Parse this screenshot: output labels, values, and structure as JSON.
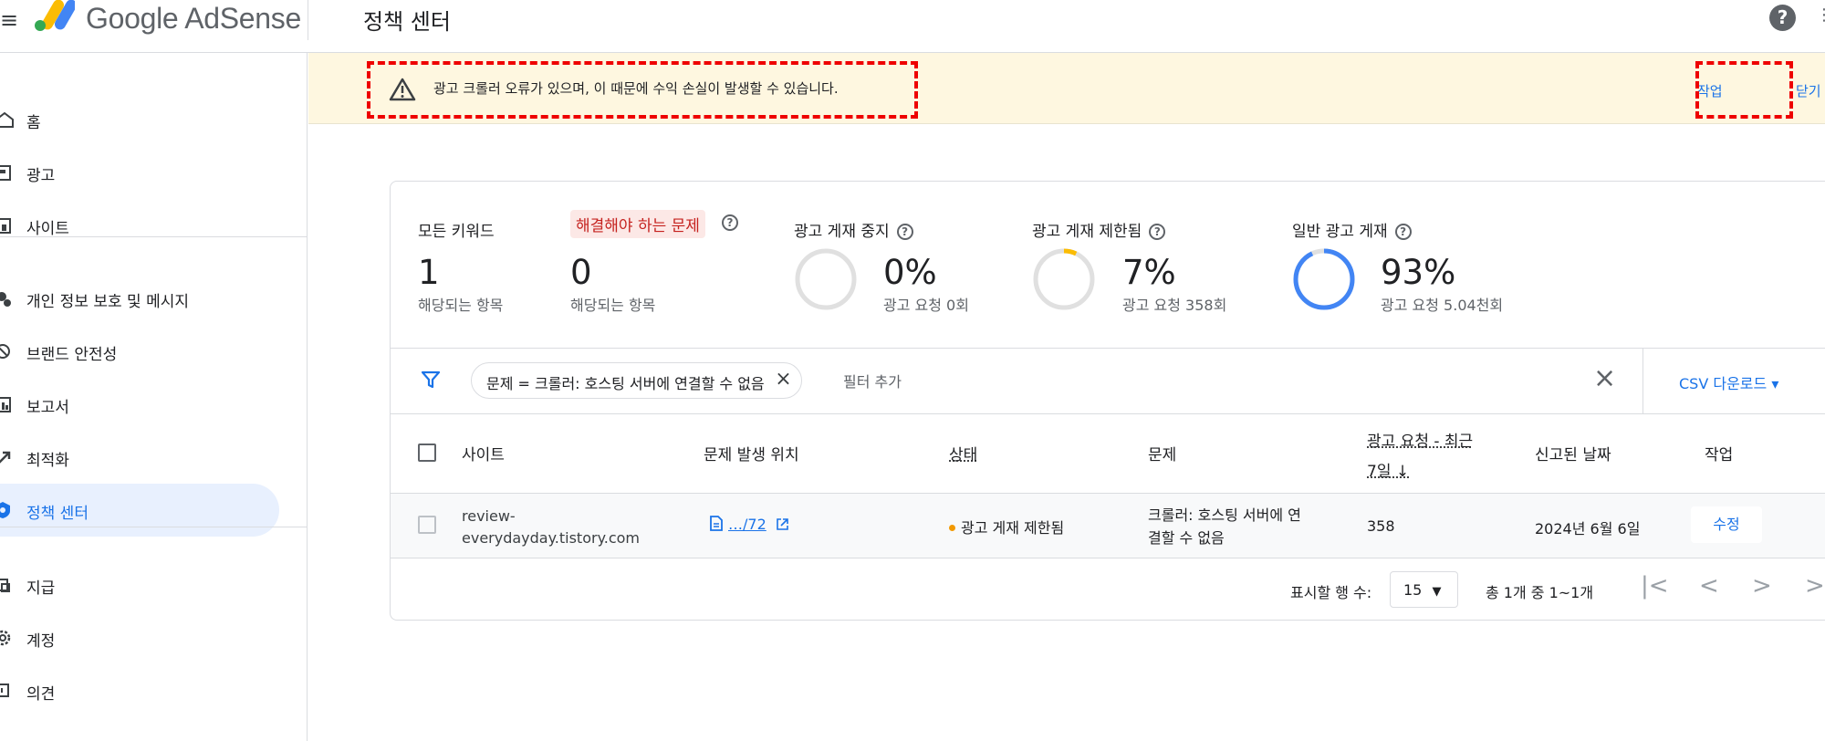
{
  "app": {
    "brand": "Google AdSense",
    "page_title": "정책 센터",
    "help": "?",
    "more": "⋮"
  },
  "sidebar": {
    "items": [
      {
        "label": "홈",
        "icon": "home-icon"
      },
      {
        "label": "광고",
        "icon": "ads-icon"
      },
      {
        "label": "사이트",
        "icon": "sites-icon"
      },
      {
        "label": "개인 정보 보호 및 메시지",
        "icon": "privacy-icon"
      },
      {
        "label": "브랜드 안전성",
        "icon": "brand-safety-icon"
      },
      {
        "label": "보고서",
        "icon": "reports-icon"
      },
      {
        "label": "최적화",
        "icon": "optimization-icon"
      },
      {
        "label": "정책 센터",
        "icon": "policy-center-icon",
        "active": true
      },
      {
        "label": "지급",
        "icon": "payments-icon"
      },
      {
        "label": "계정",
        "icon": "gear-icon"
      },
      {
        "label": "의견",
        "icon": "feedback-icon"
      }
    ]
  },
  "banner": {
    "message": "광고 크롤러 오류가 있으며, 이 때문에 수익 손실이 발생할 수 있습니다.",
    "action_label": "작업",
    "close_label": "닫기"
  },
  "stats": {
    "all_keywords": {
      "label": "모든 키워드",
      "value": "1",
      "sub": "해당되는 항목"
    },
    "issues": {
      "label": "해결해야 하는 문제",
      "value": "0",
      "sub": "해당되는 항목"
    },
    "ads_stopped": {
      "label": "광고 게재 중지",
      "value": "0%",
      "sub": "광고 요청 0회",
      "fraction": 0
    },
    "ads_limited": {
      "label": "광고 게재 제한됨",
      "value": "7%",
      "sub": "광고 요청 358회",
      "fraction": 0.07
    },
    "ads_normal": {
      "label": "일반 광고 게재",
      "value": "93%",
      "sub": "광고 요청 5.04천회",
      "fraction": 0.93
    }
  },
  "filter": {
    "chip_label": "문제 = 크롤러: 호스팅 서버에 연결할 수 없음",
    "add_filter": "필터 추가",
    "csv_label": "CSV 다운로드"
  },
  "table": {
    "headers": {
      "site": "사이트",
      "location": "문제 발생 위치",
      "status": "상태",
      "issue": "문제",
      "requests_l1": "광고 요청 - 최근",
      "requests_l2": "7일 ↓",
      "reported": "신고된 날짜",
      "action": "작업"
    },
    "rows": [
      {
        "site_l1": "review-",
        "site_l2": "everydayday.tistory.com",
        "location": "…/72",
        "status": "광고 게재 제한됨",
        "issue_l1": "크롤러: 호스팅 서버에 연",
        "issue_l2": "결할 수 없음",
        "requests": "358",
        "reported": "2024년 6월 6일",
        "action": "수정"
      }
    ]
  },
  "pagination": {
    "rows_label": "표시할 행 수:",
    "rows_value": "15",
    "range": "총 1개 중 1~1개"
  },
  "colors": {
    "accent": "#1a73e8",
    "warning": "#fbbc04",
    "banner_bg": "#fef7e0",
    "annotation": "#ee0000"
  }
}
